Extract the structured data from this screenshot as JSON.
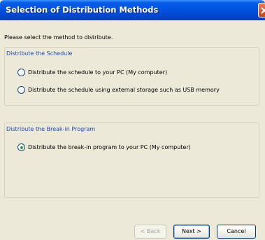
{
  "window": {
    "title": "Selection of Distribution Methods"
  },
  "prompt": "Please select the method to distribute.",
  "groups": [
    {
      "title": "Distribute the Schedule",
      "options": [
        {
          "label": "Distribute the schedule to your PC (My computer)",
          "checked": false
        },
        {
          "label": "Distribute the schedule using external storage such as USB memory",
          "checked": false
        }
      ]
    },
    {
      "title": "Distribute the Break-in Program",
      "options": [
        {
          "label": "Distribute the break-in program to your PC (My computer)",
          "checked": true
        }
      ]
    }
  ],
  "buttons": {
    "back": "< Back",
    "next": "Next >",
    "cancel": "Cancel"
  },
  "colors": {
    "title_bar": "#0054e3",
    "group_title": "#1e4ab4",
    "close_button": "#d9552c"
  },
  "icons": {
    "close": "close-icon"
  }
}
